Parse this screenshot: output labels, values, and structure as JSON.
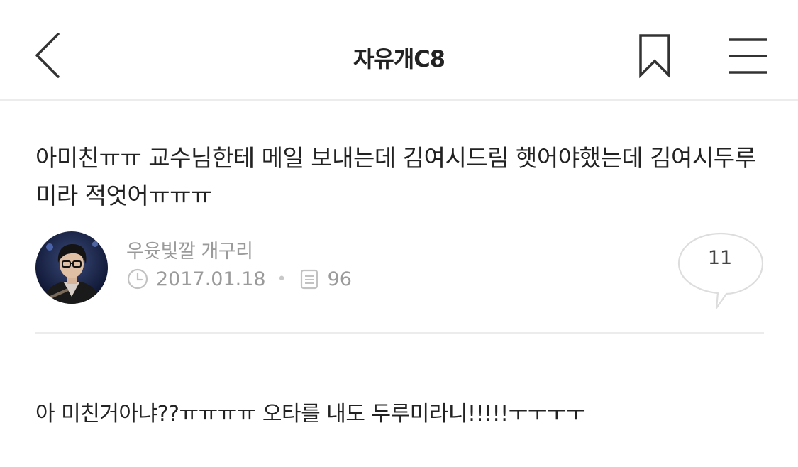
{
  "header": {
    "back_icon": "chevron-left-icon",
    "title": "자유개C8",
    "bookmark_icon": "bookmark-icon",
    "menu_icon": "hamburger-menu-icon"
  },
  "post": {
    "title": "아미친ㅠㅠ 교수님한테 메일 보내는데 김여시드림 햇어야했는데 김여시두루미라 적엇어ㅠㅠㅠ",
    "author": "우윳빛깔 개구리",
    "date": "2017.01.18",
    "views": "96",
    "comment_count": "11",
    "body": "아 미친거아냐??ㅠㅠㅠㅠ 오타를 내도 두루미라니!!!!!ㅜㅜㅜㅜ"
  },
  "colors": {
    "text_primary": "#222222",
    "text_muted": "#9a9a9a",
    "divider": "#ececec",
    "background": "#ffffff"
  }
}
